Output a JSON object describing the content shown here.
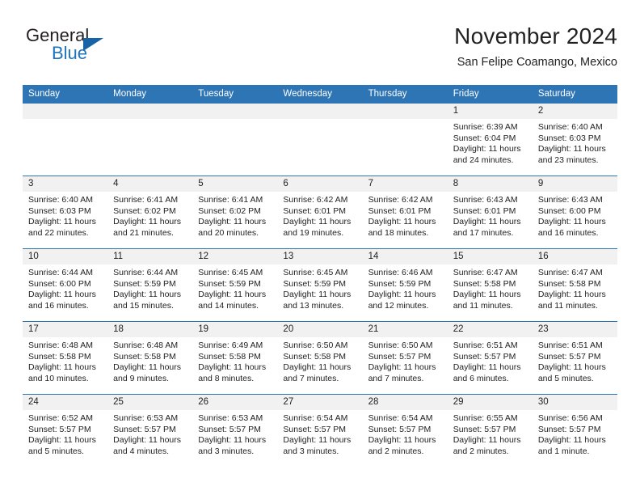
{
  "brand": {
    "name_part1": "General",
    "name_part2": "Blue",
    "triangle_color": "#1663a8",
    "blue_text_color": "#1e73be"
  },
  "header": {
    "title": "November 2024",
    "subtitle": "San Felipe Coamango, Mexico",
    "accent_color": "#2e75b6"
  },
  "calendar": {
    "weekday_headers": [
      "Sunday",
      "Monday",
      "Tuesday",
      "Wednesday",
      "Thursday",
      "Friday",
      "Saturday"
    ],
    "weeks": [
      [
        {
          "day": "",
          "sunrise": "",
          "sunset": "",
          "daylight_line1": "",
          "daylight_line2": "",
          "empty": true
        },
        {
          "day": "",
          "sunrise": "",
          "sunset": "",
          "daylight_line1": "",
          "daylight_line2": "",
          "empty": true
        },
        {
          "day": "",
          "sunrise": "",
          "sunset": "",
          "daylight_line1": "",
          "daylight_line2": "",
          "empty": true
        },
        {
          "day": "",
          "sunrise": "",
          "sunset": "",
          "daylight_line1": "",
          "daylight_line2": "",
          "empty": true
        },
        {
          "day": "",
          "sunrise": "",
          "sunset": "",
          "daylight_line1": "",
          "daylight_line2": "",
          "empty": true
        },
        {
          "day": "1",
          "sunrise": "Sunrise: 6:39 AM",
          "sunset": "Sunset: 6:04 PM",
          "daylight_line1": "Daylight: 11 hours",
          "daylight_line2": "and 24 minutes.",
          "empty": false
        },
        {
          "day": "2",
          "sunrise": "Sunrise: 6:40 AM",
          "sunset": "Sunset: 6:03 PM",
          "daylight_line1": "Daylight: 11 hours",
          "daylight_line2": "and 23 minutes.",
          "empty": false
        }
      ],
      [
        {
          "day": "3",
          "sunrise": "Sunrise: 6:40 AM",
          "sunset": "Sunset: 6:03 PM",
          "daylight_line1": "Daylight: 11 hours",
          "daylight_line2": "and 22 minutes.",
          "empty": false
        },
        {
          "day": "4",
          "sunrise": "Sunrise: 6:41 AM",
          "sunset": "Sunset: 6:02 PM",
          "daylight_line1": "Daylight: 11 hours",
          "daylight_line2": "and 21 minutes.",
          "empty": false
        },
        {
          "day": "5",
          "sunrise": "Sunrise: 6:41 AM",
          "sunset": "Sunset: 6:02 PM",
          "daylight_line1": "Daylight: 11 hours",
          "daylight_line2": "and 20 minutes.",
          "empty": false
        },
        {
          "day": "6",
          "sunrise": "Sunrise: 6:42 AM",
          "sunset": "Sunset: 6:01 PM",
          "daylight_line1": "Daylight: 11 hours",
          "daylight_line2": "and 19 minutes.",
          "empty": false
        },
        {
          "day": "7",
          "sunrise": "Sunrise: 6:42 AM",
          "sunset": "Sunset: 6:01 PM",
          "daylight_line1": "Daylight: 11 hours",
          "daylight_line2": "and 18 minutes.",
          "empty": false
        },
        {
          "day": "8",
          "sunrise": "Sunrise: 6:43 AM",
          "sunset": "Sunset: 6:01 PM",
          "daylight_line1": "Daylight: 11 hours",
          "daylight_line2": "and 17 minutes.",
          "empty": false
        },
        {
          "day": "9",
          "sunrise": "Sunrise: 6:43 AM",
          "sunset": "Sunset: 6:00 PM",
          "daylight_line1": "Daylight: 11 hours",
          "daylight_line2": "and 16 minutes.",
          "empty": false
        }
      ],
      [
        {
          "day": "10",
          "sunrise": "Sunrise: 6:44 AM",
          "sunset": "Sunset: 6:00 PM",
          "daylight_line1": "Daylight: 11 hours",
          "daylight_line2": "and 16 minutes.",
          "empty": false
        },
        {
          "day": "11",
          "sunrise": "Sunrise: 6:44 AM",
          "sunset": "Sunset: 5:59 PM",
          "daylight_line1": "Daylight: 11 hours",
          "daylight_line2": "and 15 minutes.",
          "empty": false
        },
        {
          "day": "12",
          "sunrise": "Sunrise: 6:45 AM",
          "sunset": "Sunset: 5:59 PM",
          "daylight_line1": "Daylight: 11 hours",
          "daylight_line2": "and 14 minutes.",
          "empty": false
        },
        {
          "day": "13",
          "sunrise": "Sunrise: 6:45 AM",
          "sunset": "Sunset: 5:59 PM",
          "daylight_line1": "Daylight: 11 hours",
          "daylight_line2": "and 13 minutes.",
          "empty": false
        },
        {
          "day": "14",
          "sunrise": "Sunrise: 6:46 AM",
          "sunset": "Sunset: 5:59 PM",
          "daylight_line1": "Daylight: 11 hours",
          "daylight_line2": "and 12 minutes.",
          "empty": false
        },
        {
          "day": "15",
          "sunrise": "Sunrise: 6:47 AM",
          "sunset": "Sunset: 5:58 PM",
          "daylight_line1": "Daylight: 11 hours",
          "daylight_line2": "and 11 minutes.",
          "empty": false
        },
        {
          "day": "16",
          "sunrise": "Sunrise: 6:47 AM",
          "sunset": "Sunset: 5:58 PM",
          "daylight_line1": "Daylight: 11 hours",
          "daylight_line2": "and 11 minutes.",
          "empty": false
        }
      ],
      [
        {
          "day": "17",
          "sunrise": "Sunrise: 6:48 AM",
          "sunset": "Sunset: 5:58 PM",
          "daylight_line1": "Daylight: 11 hours",
          "daylight_line2": "and 10 minutes.",
          "empty": false
        },
        {
          "day": "18",
          "sunrise": "Sunrise: 6:48 AM",
          "sunset": "Sunset: 5:58 PM",
          "daylight_line1": "Daylight: 11 hours",
          "daylight_line2": "and 9 minutes.",
          "empty": false
        },
        {
          "day": "19",
          "sunrise": "Sunrise: 6:49 AM",
          "sunset": "Sunset: 5:58 PM",
          "daylight_line1": "Daylight: 11 hours",
          "daylight_line2": "and 8 minutes.",
          "empty": false
        },
        {
          "day": "20",
          "sunrise": "Sunrise: 6:50 AM",
          "sunset": "Sunset: 5:58 PM",
          "daylight_line1": "Daylight: 11 hours",
          "daylight_line2": "and 7 minutes.",
          "empty": false
        },
        {
          "day": "21",
          "sunrise": "Sunrise: 6:50 AM",
          "sunset": "Sunset: 5:57 PM",
          "daylight_line1": "Daylight: 11 hours",
          "daylight_line2": "and 7 minutes.",
          "empty": false
        },
        {
          "day": "22",
          "sunrise": "Sunrise: 6:51 AM",
          "sunset": "Sunset: 5:57 PM",
          "daylight_line1": "Daylight: 11 hours",
          "daylight_line2": "and 6 minutes.",
          "empty": false
        },
        {
          "day": "23",
          "sunrise": "Sunrise: 6:51 AM",
          "sunset": "Sunset: 5:57 PM",
          "daylight_line1": "Daylight: 11 hours",
          "daylight_line2": "and 5 minutes.",
          "empty": false
        }
      ],
      [
        {
          "day": "24",
          "sunrise": "Sunrise: 6:52 AM",
          "sunset": "Sunset: 5:57 PM",
          "daylight_line1": "Daylight: 11 hours",
          "daylight_line2": "and 5 minutes.",
          "empty": false
        },
        {
          "day": "25",
          "sunrise": "Sunrise: 6:53 AM",
          "sunset": "Sunset: 5:57 PM",
          "daylight_line1": "Daylight: 11 hours",
          "daylight_line2": "and 4 minutes.",
          "empty": false
        },
        {
          "day": "26",
          "sunrise": "Sunrise: 6:53 AM",
          "sunset": "Sunset: 5:57 PM",
          "daylight_line1": "Daylight: 11 hours",
          "daylight_line2": "and 3 minutes.",
          "empty": false
        },
        {
          "day": "27",
          "sunrise": "Sunrise: 6:54 AM",
          "sunset": "Sunset: 5:57 PM",
          "daylight_line1": "Daylight: 11 hours",
          "daylight_line2": "and 3 minutes.",
          "empty": false
        },
        {
          "day": "28",
          "sunrise": "Sunrise: 6:54 AM",
          "sunset": "Sunset: 5:57 PM",
          "daylight_line1": "Daylight: 11 hours",
          "daylight_line2": "and 2 minutes.",
          "empty": false
        },
        {
          "day": "29",
          "sunrise": "Sunrise: 6:55 AM",
          "sunset": "Sunset: 5:57 PM",
          "daylight_line1": "Daylight: 11 hours",
          "daylight_line2": "and 2 minutes.",
          "empty": false
        },
        {
          "day": "30",
          "sunrise": "Sunrise: 6:56 AM",
          "sunset": "Sunset: 5:57 PM",
          "daylight_line1": "Daylight: 11 hours",
          "daylight_line2": "and 1 minute.",
          "empty": false
        }
      ]
    ]
  }
}
